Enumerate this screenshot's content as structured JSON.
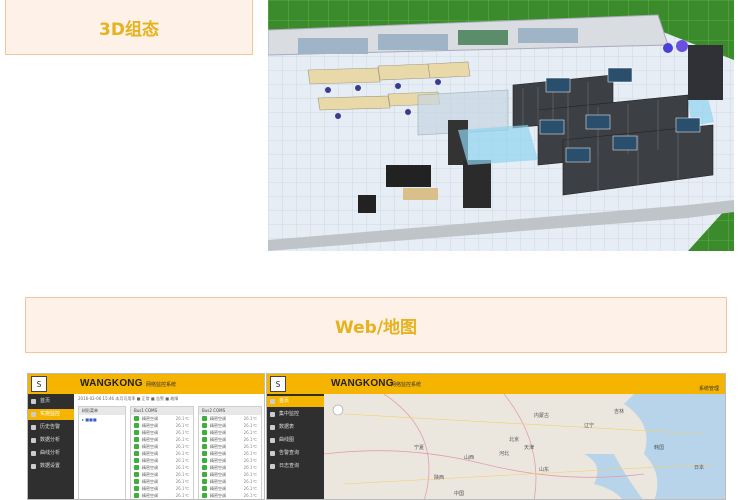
{
  "sections": {
    "three_d_title": "3D组态",
    "web_title": "Web/地图"
  },
  "left_app": {
    "logo_text": "S",
    "brand": "WANGKONG",
    "brand_sub": "网络监控系统",
    "sidebar": [
      {
        "label": "首页",
        "active": false
      },
      {
        "label": "实施监控",
        "active": true
      },
      {
        "label": "历史告警",
        "active": false
      },
      {
        "label": "数据分析",
        "active": false
      },
      {
        "label": "曲线分析",
        "active": false
      },
      {
        "label": "数据设置",
        "active": false
      }
    ],
    "toolbar_text": "2016-02-06 15:46   本月可用率 ■ 正常 ■ 告警 ■ 故障",
    "tree_header": "树形菜单",
    "panels": [
      {
        "header": "Bus1 COMS",
        "rows": [
          {
            "name": "精密空调",
            "value": "26.1℃"
          },
          {
            "name": "精密空调",
            "value": "26.1℃"
          },
          {
            "name": "精密空调",
            "value": "26.1℃"
          },
          {
            "name": "精密空调",
            "value": "26.1℃"
          },
          {
            "name": "精密空调",
            "value": "26.1℃"
          },
          {
            "name": "精密空调",
            "value": "26.1℃"
          },
          {
            "name": "精密空调",
            "value": "26.1℃"
          },
          {
            "name": "精密空调",
            "value": "26.1℃"
          },
          {
            "name": "精密空调",
            "value": "26.1℃"
          },
          {
            "name": "精密空调",
            "value": "26.1℃"
          },
          {
            "name": "精密空调",
            "value": "26.1℃"
          },
          {
            "name": "精密空调",
            "value": "26.1℃"
          }
        ]
      },
      {
        "header": "Bus2 COMS",
        "rows": [
          {
            "name": "精密空调",
            "value": "26.1℃"
          },
          {
            "name": "精密空调",
            "value": "26.1℃"
          },
          {
            "name": "精密空调",
            "value": "26.1℃"
          },
          {
            "name": "精密空调",
            "value": "26.1℃"
          },
          {
            "name": "精密空调",
            "value": "26.1℃"
          },
          {
            "name": "精密空调",
            "value": "26.1℃"
          },
          {
            "name": "精密空调",
            "value": "26.1℃"
          },
          {
            "name": "精密空调",
            "value": "26.1℃"
          },
          {
            "name": "精密空调",
            "value": "26.1℃"
          },
          {
            "name": "精密空调",
            "value": "26.1℃"
          },
          {
            "name": "精密空调",
            "value": "26.1℃"
          },
          {
            "name": "精密空调",
            "value": "26.1℃"
          }
        ]
      }
    ]
  },
  "right_app": {
    "logo_text": "S",
    "brand": "WANGKONG",
    "brand_sub": "网络监控系统",
    "user_text": "系统管理",
    "sidebar": [
      {
        "label": "首页",
        "active": true
      },
      {
        "label": "集中监控",
        "active": false
      },
      {
        "label": "数据表",
        "active": false
      },
      {
        "label": "曲线图",
        "active": false
      },
      {
        "label": "告警查询",
        "active": false
      },
      {
        "label": "日志查询",
        "active": false
      }
    ],
    "map_labels": [
      "内蒙古",
      "北京",
      "天津",
      "河北",
      "山西",
      "宁夏",
      "陕西",
      "山东",
      "中国",
      "辽宁",
      "吉林",
      "韩国",
      "日本"
    ]
  },
  "colors": {
    "accent": "#f5b400",
    "section_bg": "#fdf1e8",
    "section_text": "#e6b21e",
    "floor_green": "#3a7f2a",
    "sidebar_dark": "#2f2f2f"
  }
}
